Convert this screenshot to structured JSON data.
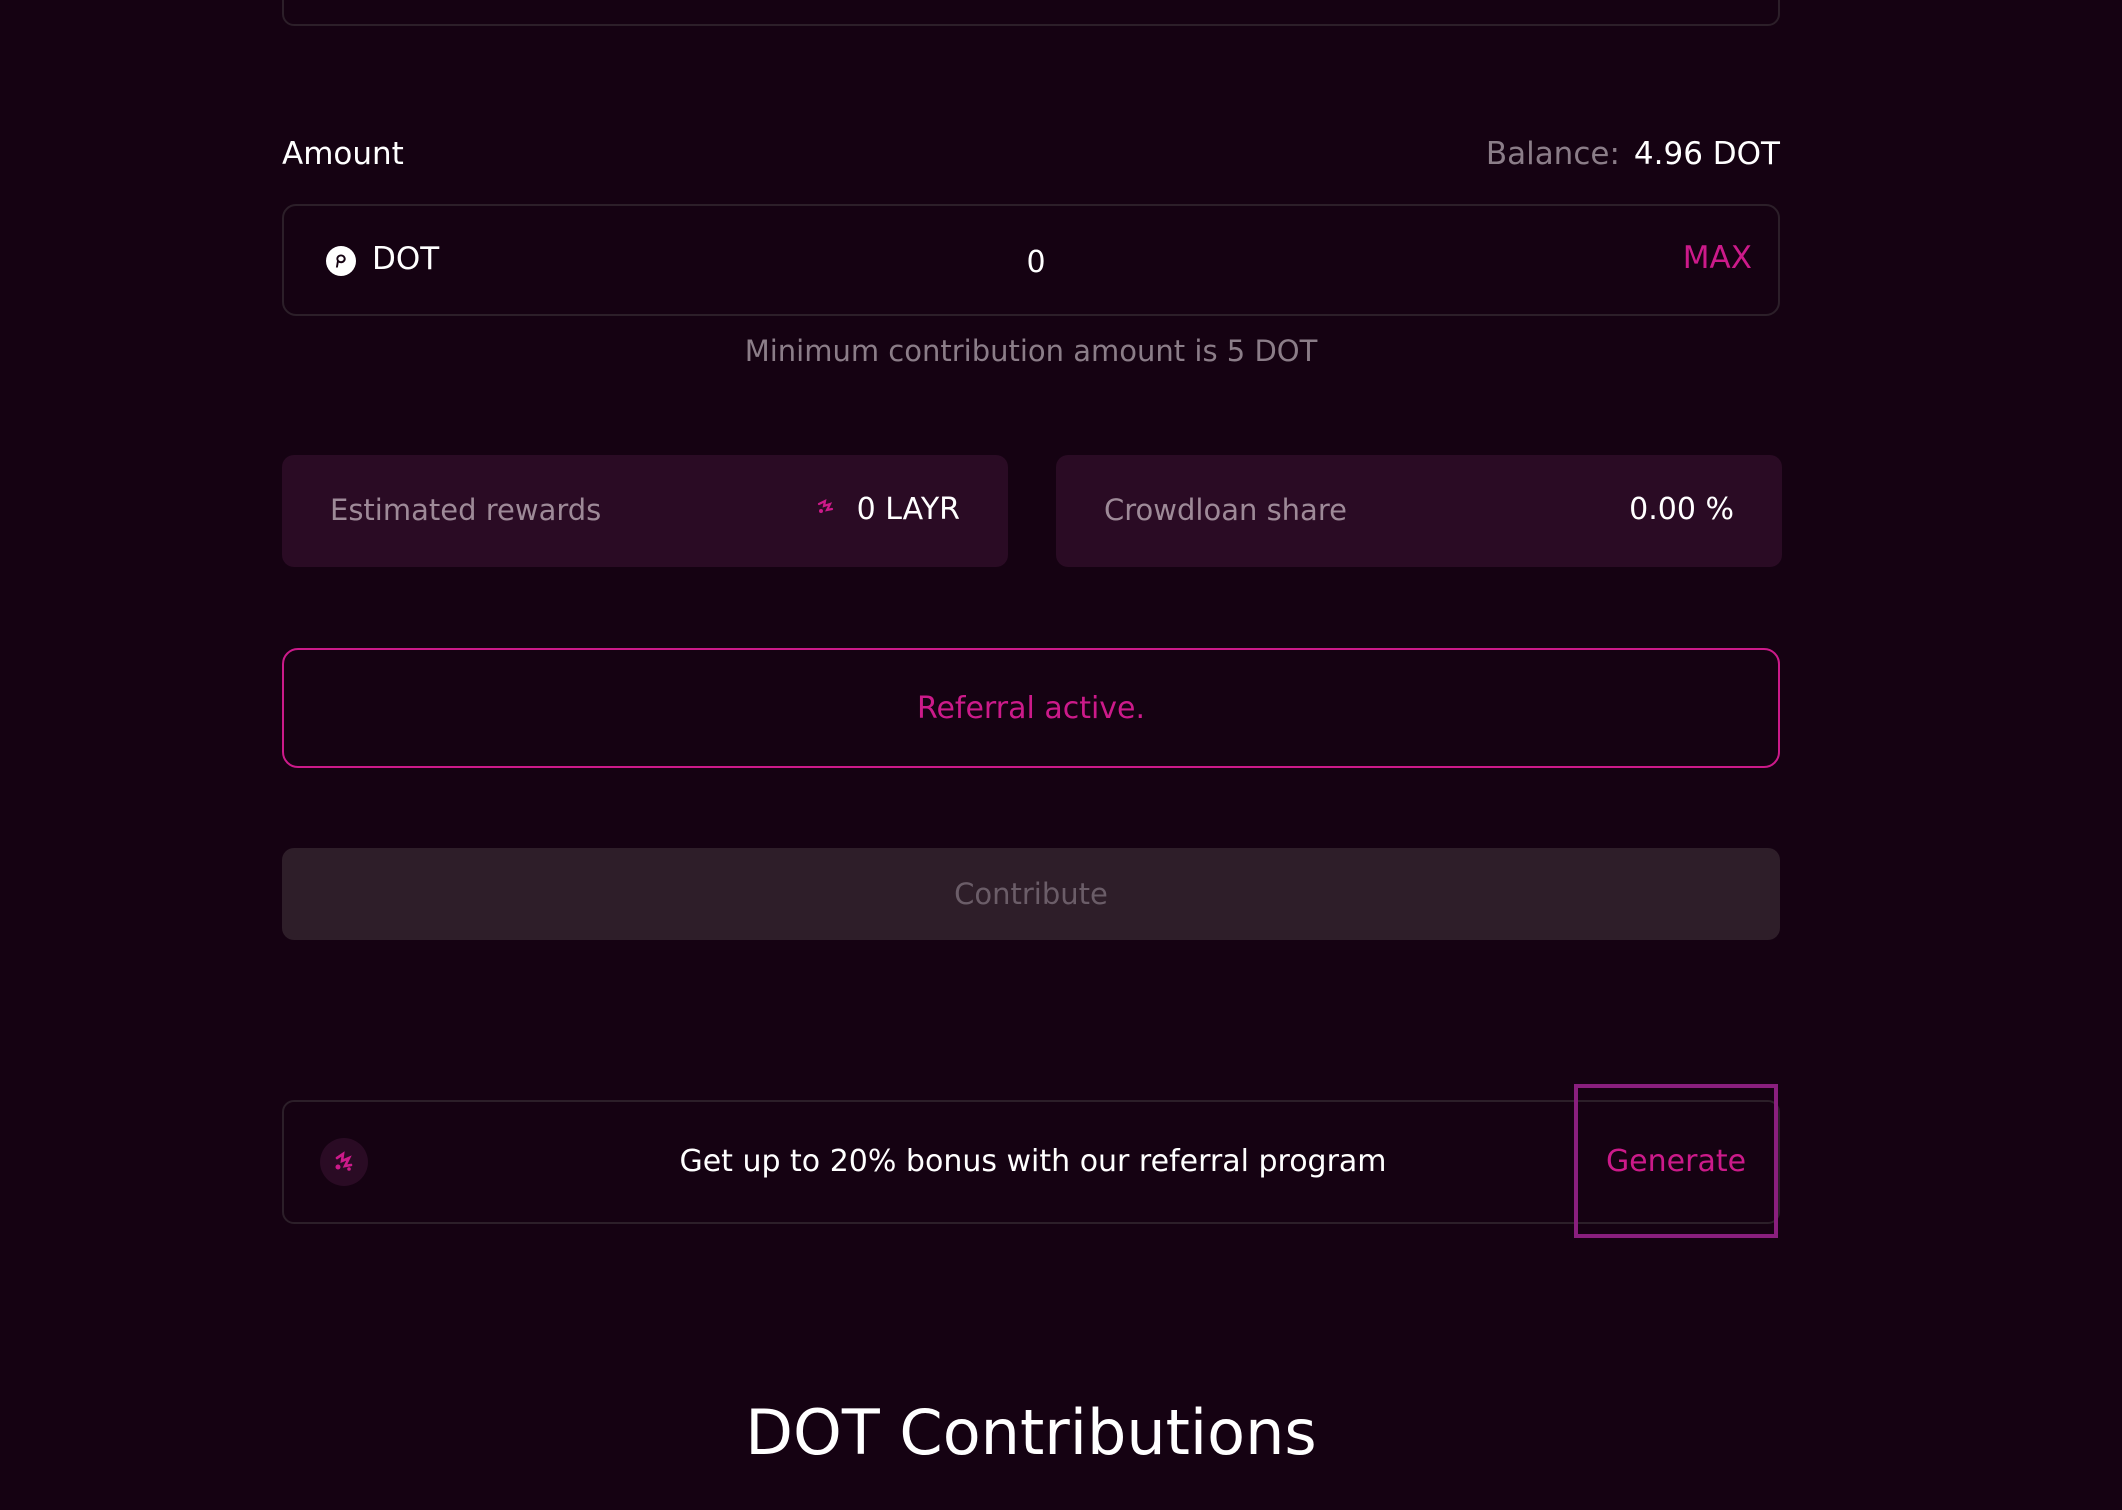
{
  "amount": {
    "label": "Amount",
    "balance_label": "Balance:",
    "balance_value": "4.96 DOT",
    "token": "DOT",
    "token_icon": "polkadot-icon",
    "input_value": "0",
    "max_label": "MAX",
    "min_note": "Minimum contribution amount is 5 DOT"
  },
  "stats": {
    "rewards_label": "Estimated rewards",
    "rewards_value": "0 LAYR",
    "rewards_icon": "layr-icon",
    "share_label": "Crowdloan share",
    "share_value": "0.00 %"
  },
  "referral": {
    "status": "Referral active."
  },
  "contribute": {
    "label": "Contribute"
  },
  "promo": {
    "icon": "layr-logo-icon",
    "text": "Get up to 20% bonus with our referral program",
    "generate_label": "Generate"
  },
  "section": {
    "title": "DOT Contributions"
  },
  "colors": {
    "background": "#150212",
    "accent": "#cc1a8a",
    "card": "#2a0b24",
    "muted": "#8b7d88"
  }
}
